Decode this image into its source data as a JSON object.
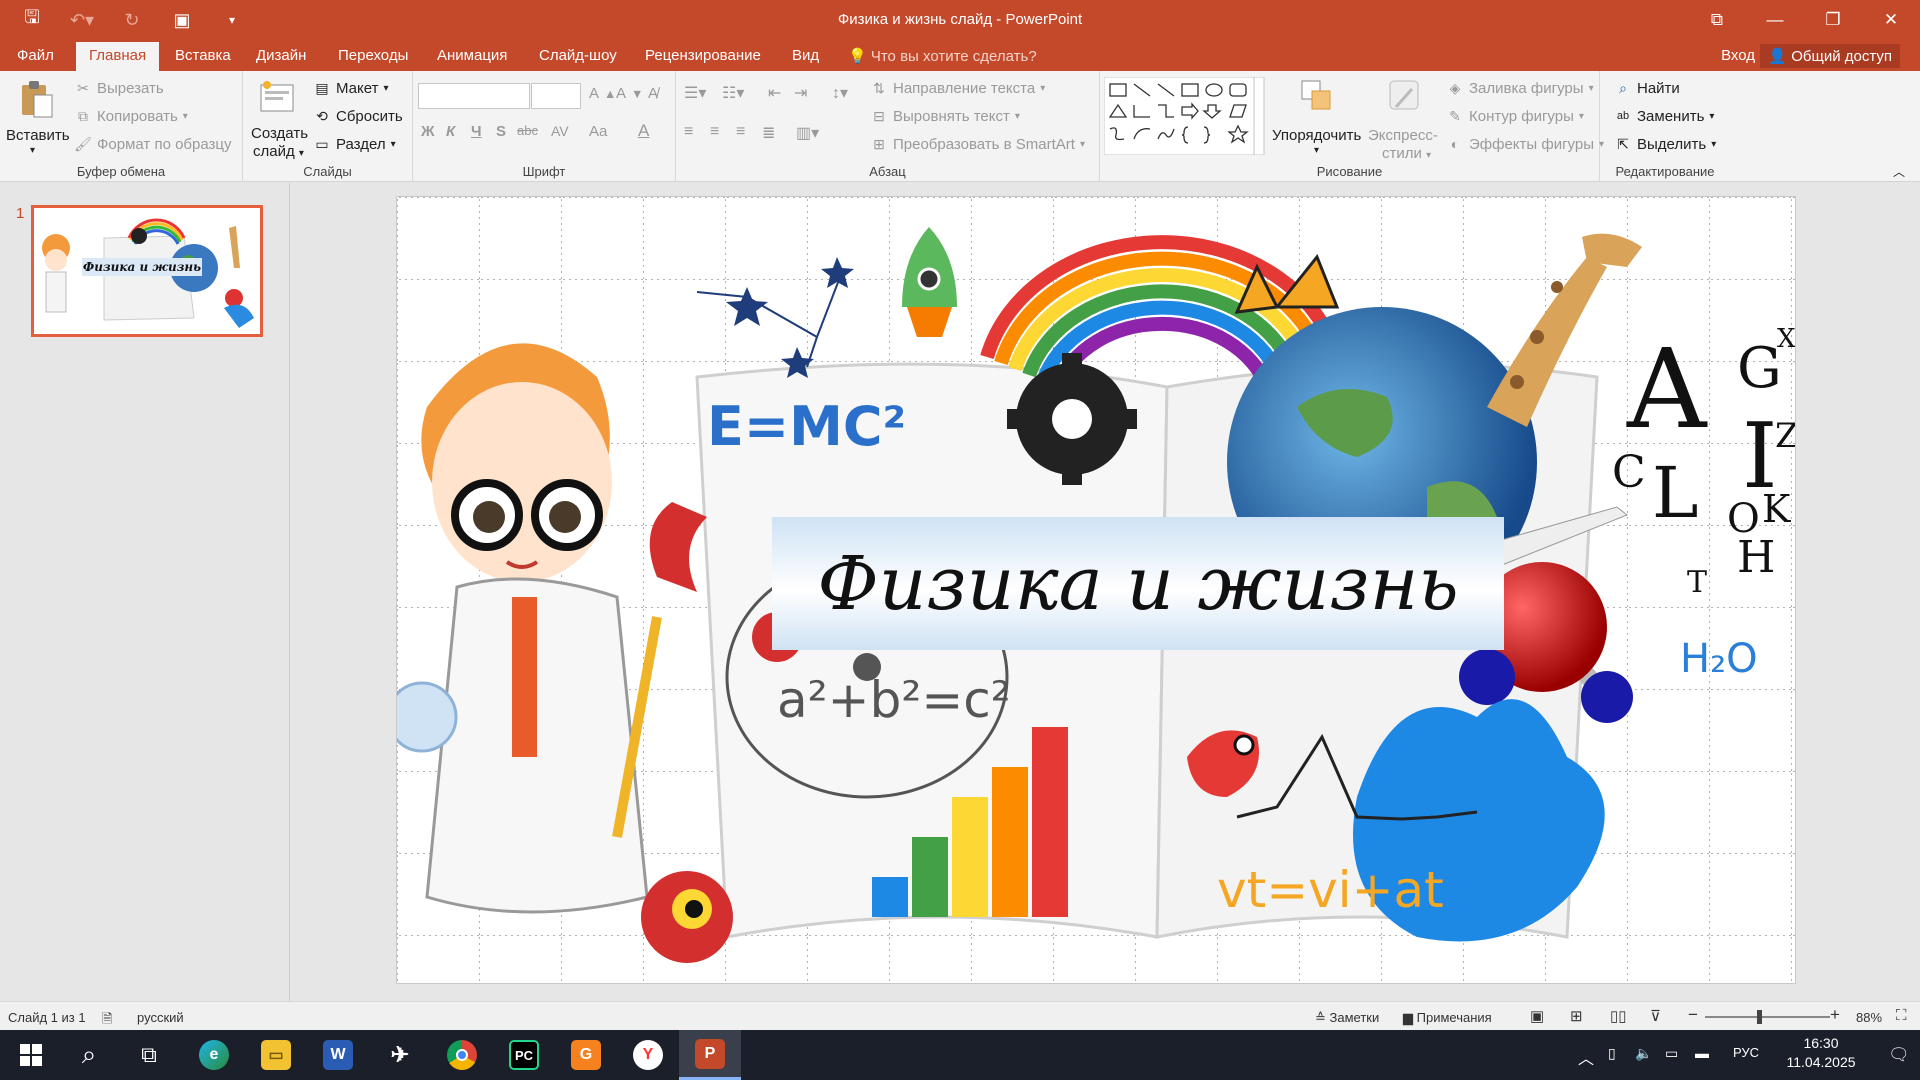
{
  "window": {
    "title": "Физика и жизнь слайд - PowerPoint",
    "qat_icons": [
      "save-icon",
      "undo-icon",
      "redo-icon",
      "start-slideshow-icon",
      "customize-qat-icon"
    ],
    "controls_icons": [
      "ribbon-display-options-icon",
      "minimize-icon",
      "restore-icon",
      "close-icon"
    ]
  },
  "tabs": [
    "Файл",
    "Главная",
    "Вставка",
    "Дизайн",
    "Переходы",
    "Анимация",
    "Слайд-шоу",
    "Рецензирование",
    "Вид"
  ],
  "active_tab": "Главная",
  "tell_me": "Что вы хотите сделать?",
  "sign_in": "Вход",
  "share": "Общий доступ",
  "ribbon": {
    "clipboard": {
      "label": "Буфер обмена",
      "paste": "Вставить",
      "cut": "Вырезать",
      "copy": "Копировать",
      "format_painter": "Формат по образцу"
    },
    "slides": {
      "label": "Слайды",
      "new_slide_line1": "Создать",
      "new_slide_line2": "слайд",
      "layout": "Макет",
      "reset": "Сбросить",
      "section": "Раздел"
    },
    "font": {
      "label": "Шрифт",
      "bold": "Ж",
      "italic": "К",
      "underline": "Ч",
      "strike": "S",
      "abc": "abc",
      "spacing": "AV",
      "case": "Aa",
      "color": "A"
    },
    "paragraph": {
      "label": "Абзац",
      "text_direction": "Направление текста",
      "align_text": "Выровнять текст",
      "smartart": "Преобразовать в SmartArt"
    },
    "drawing": {
      "label": "Рисование",
      "arrange": "Упорядочить",
      "quick_styles_line1": "Экспресс-",
      "quick_styles_line2": "стили",
      "shape_fill": "Заливка фигуры",
      "shape_outline": "Контур фигуры",
      "shape_effects": "Эффекты фигуры"
    },
    "editing": {
      "label": "Редактирование",
      "find": "Найти",
      "replace": "Заменить",
      "select": "Выделить"
    }
  },
  "thumbnail": {
    "number": "1",
    "title": "Физика и жизнь"
  },
  "slide": {
    "title": "Физика и жизнь",
    "formulas": [
      "E=MC²",
      "a²+b²=c²",
      "vt=vi+at",
      "H₂O"
    ],
    "letters": [
      "A",
      "G",
      "X",
      "I",
      "Z",
      "C",
      "L",
      "O",
      "K",
      "T",
      "H"
    ]
  },
  "status": {
    "slide_info": "Слайд 1 из 1",
    "language": "русский",
    "notes": "Заметки",
    "comments": "Примечания",
    "zoom": "88%"
  },
  "taskbar": {
    "apps": [
      "windows-start-icon",
      "search-icon",
      "task-view-icon",
      "edge-icon",
      "file-explorer-icon",
      "word-icon",
      "xbox-icon",
      "chrome-icon",
      "pycharm-icon",
      "sber-icon",
      "yandex-browser-icon",
      "powerpoint-icon"
    ],
    "lang": "РУС",
    "time": "16:30",
    "date": "11.04.2025"
  },
  "colors": {
    "accent": "#c4482a",
    "active_border": "#e35f3e",
    "taskbar": "#1b1f2a"
  }
}
